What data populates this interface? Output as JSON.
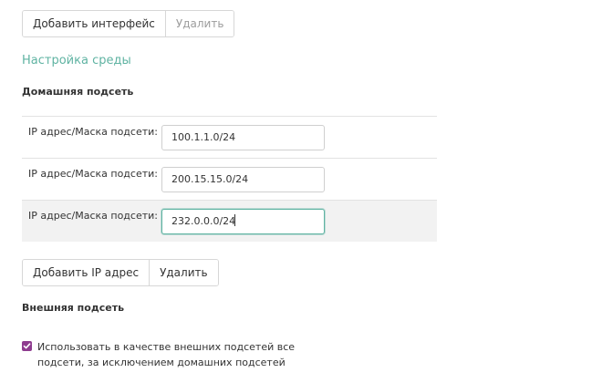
{
  "top_toolbar": {
    "add_interface_label": "Добавить интерфейс",
    "delete_label": "Удалить"
  },
  "environment": {
    "title": "Настройка среды"
  },
  "home_subnet": {
    "title": "Домашняя подсеть",
    "rows": [
      {
        "label": "IP адрес/Маска подсети:",
        "value": "100.1.1.0/24"
      },
      {
        "label": "IP адрес/Маска подсети:",
        "value": "200.15.15.0/24"
      },
      {
        "label": "IP адрес/Маска подсети:",
        "value": "232.0.0.0/24"
      }
    ],
    "add_ip_label": "Добавить IP адрес",
    "delete_label": "Удалить"
  },
  "external_subnet": {
    "title": "Внешняя подсеть",
    "use_all_checked": true,
    "use_all_label": "Использовать в качестве внешних подсетей все подсети, за исключением домашних подсетей"
  },
  "colors": {
    "accent": "#5fb3a2",
    "checkbox": "#8e3c8f"
  }
}
